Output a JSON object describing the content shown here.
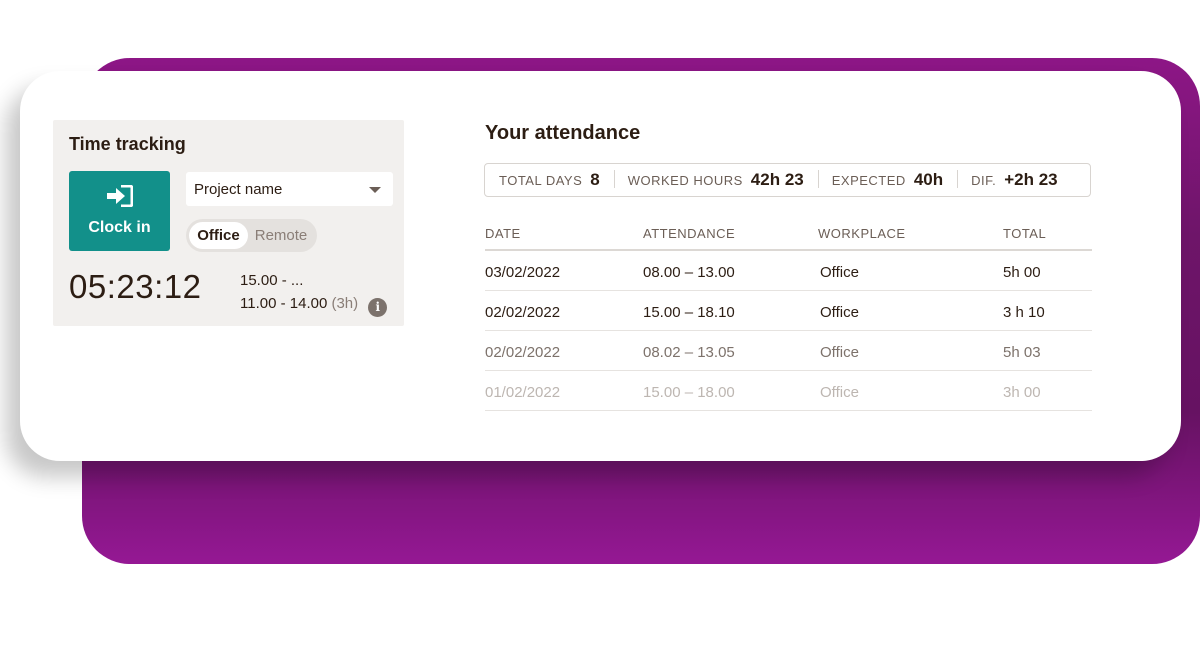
{
  "colors": {
    "accent": "#12908a",
    "backdrop": "#6e1569",
    "text": "#2c1d13"
  },
  "time_tracking": {
    "title": "Time tracking",
    "clock_in_label": "Clock in",
    "clock_in_icon": "sign-in-icon",
    "project_placeholder": "Project name",
    "workplace_toggle": {
      "active": "Office",
      "inactive": "Remote"
    },
    "timer": "05:23:12",
    "sessions": [
      {
        "range": "15.00 - ...",
        "duration": ""
      },
      {
        "range": "11.00 - 14.00",
        "duration": "(3h)"
      }
    ],
    "info_icon": "i"
  },
  "attendance": {
    "title": "Your attendance",
    "summary": [
      {
        "label": "TOTAL DAYS",
        "value": "8"
      },
      {
        "label": "WORKED HOURS",
        "value": "42h 23"
      },
      {
        "label": "EXPECTED",
        "value": "40h"
      },
      {
        "label": "DIF.",
        "value": "+2h 23"
      }
    ],
    "columns": [
      "DATE",
      "ATTENDANCE",
      "WORKPLACE",
      "TOTAL"
    ],
    "rows": [
      {
        "date": "03/02/2022",
        "attendance": "08.00 – 13.00",
        "workplace": "Office",
        "total": "5h 00",
        "color": "#2c1d13"
      },
      {
        "date": "02/02/2022",
        "attendance": "15.00 – 18.10",
        "workplace": "Office",
        "total": "3 h 10",
        "color": "#2c1d13"
      },
      {
        "date": "02/02/2022",
        "attendance": "08.02 – 13.05",
        "workplace": "Office",
        "total": "5h 03",
        "color": "#7d726b"
      },
      {
        "date": "01/02/2022",
        "attendance": "15.00 – 18.00",
        "workplace": "Office",
        "total": "3h 00",
        "color": "#bdb6b1"
      }
    ]
  }
}
